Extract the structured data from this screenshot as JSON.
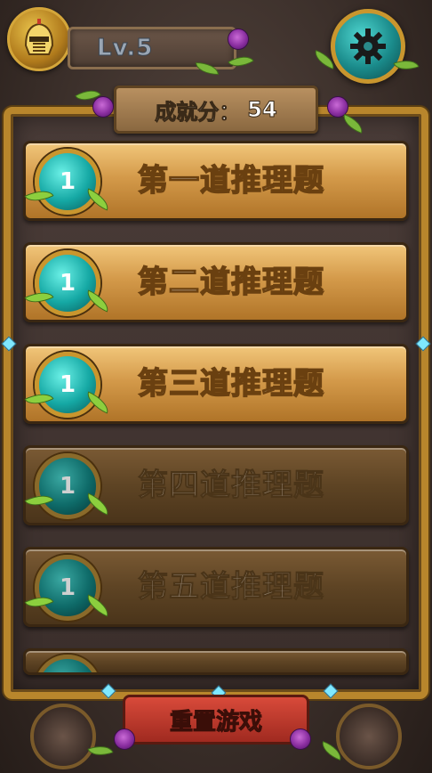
{
  "header": {
    "level_text": "Lv.5",
    "avatar_icon": "knight-helmet-icon",
    "settings_icon": "gear-icon"
  },
  "score": {
    "label": "成就分：",
    "value": "54"
  },
  "puzzles": [
    {
      "badge": "1",
      "title": "第一道推理题",
      "locked": false
    },
    {
      "badge": "1",
      "title": "第二道推理题",
      "locked": false
    },
    {
      "badge": "1",
      "title": "第三道推理题",
      "locked": false
    },
    {
      "badge": "1",
      "title": "第四道推理题",
      "locked": true
    },
    {
      "badge": "1",
      "title": "第五道推理题",
      "locked": true
    }
  ],
  "footer": {
    "restart_label": "重置游戏"
  },
  "colors": {
    "frame_gold": "#b8862c",
    "item_gold": "#d49a4a",
    "badge_teal": "#15a8a4",
    "restart_red": "#c0392b"
  }
}
